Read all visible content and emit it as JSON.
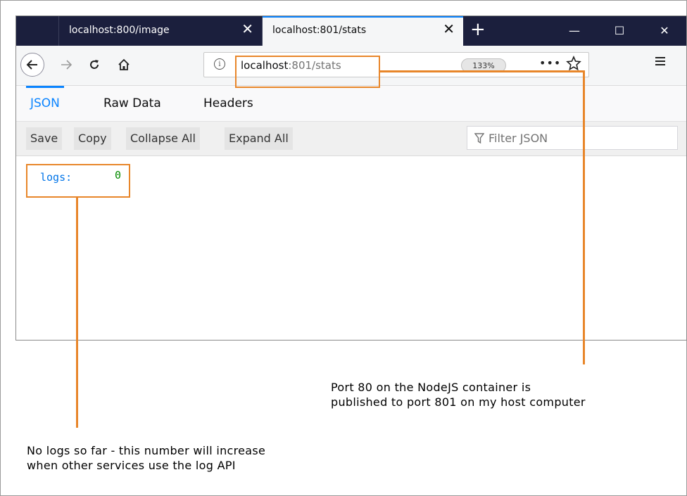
{
  "tabs": [
    {
      "title": "localhost:800/image",
      "close": "✕"
    },
    {
      "title": "localhost:801/stats",
      "close": "✕"
    }
  ],
  "new_tab": "+",
  "window_controls": [
    "—",
    "☐",
    "✕"
  ],
  "address_bar": {
    "url_host": "localhost",
    "url_rest": ":801/stats",
    "zoom": "133%",
    "more": "•••"
  },
  "viewer_tabs": [
    {
      "label": "JSON",
      "active": true
    },
    {
      "label": "Raw Data",
      "active": false
    },
    {
      "label": "Headers",
      "active": false
    }
  ],
  "toolbar": {
    "save": "Save",
    "copy": "Copy",
    "collapse_all": "Collapse All",
    "expand_all": "Expand All",
    "filter_placeholder": "Filter JSON"
  },
  "json": {
    "key": "logs:",
    "value": "0"
  },
  "annotations": {
    "port_note_line1": "Port 80 on the NodeJS container is",
    "port_note_line2": "published to port 801 on my host computer",
    "logs_note_line1": "No logs so far - this number will increase",
    "logs_note_line2": "when other services use the log API"
  },
  "colors": {
    "accent": "#0a84ff",
    "annotation": "#e8862a",
    "tabbar": "#1b1f3d",
    "json_key": "#0074e8",
    "json_number": "#058b00"
  }
}
